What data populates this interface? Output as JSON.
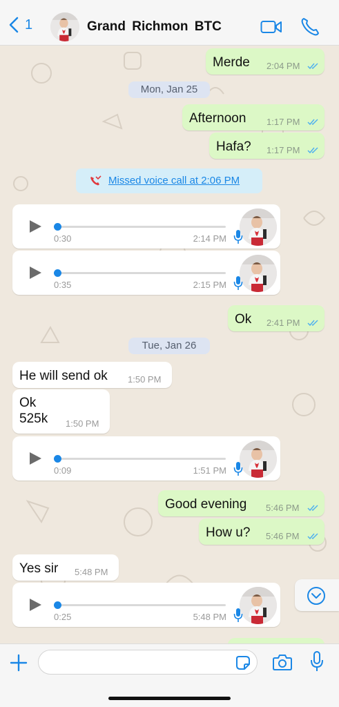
{
  "header": {
    "back_label": "1",
    "contact_name": "Grand  Richmon  BTC",
    "icons": [
      "chevron-left-icon",
      "video-call-icon",
      "phone-icon"
    ]
  },
  "messages": [
    {
      "text": "Merde",
      "time": "2:04 PM"
    },
    {
      "date": "Mon, Jan 25"
    },
    {
      "text": "Afternoon",
      "time": "1:17 PM"
    },
    {
      "text": "Hafa?",
      "time": "1:17 PM"
    },
    {
      "missed_call": "Missed voice call at 2:06 PM"
    },
    {
      "voice_duration": "0:30",
      "time": "2:14 PM"
    },
    {
      "voice_duration": "0:35",
      "time": "2:15 PM"
    },
    {
      "text": "Ok",
      "time": "2:41 PM"
    },
    {
      "date": "Tue, Jan 26"
    },
    {
      "text": "He will send ok",
      "time": "1:50 PM"
    },
    {
      "text": "Ok\n525k",
      "time": "1:50 PM"
    },
    {
      "voice_duration": "0:09",
      "time": "1:51 PM"
    },
    {
      "text": "Good evening",
      "time": "5:46 PM"
    },
    {
      "text": "How u?",
      "time": "5:46 PM"
    },
    {
      "text": "Yes sir",
      "time": "5:48 PM"
    },
    {
      "voice_duration": "0:25",
      "time": "5:48 PM"
    }
  ],
  "colors": {
    "accent": "#1a87e6",
    "outgoing_bubble": "#dcf8c6",
    "incoming_bubble": "#ffffff",
    "chat_background": "#efe8de",
    "missed_call_red": "#e0393e"
  },
  "footer": {
    "input_value": "",
    "icons": [
      "plus-icon",
      "sticker-icon",
      "camera-icon",
      "microphone-icon"
    ]
  }
}
